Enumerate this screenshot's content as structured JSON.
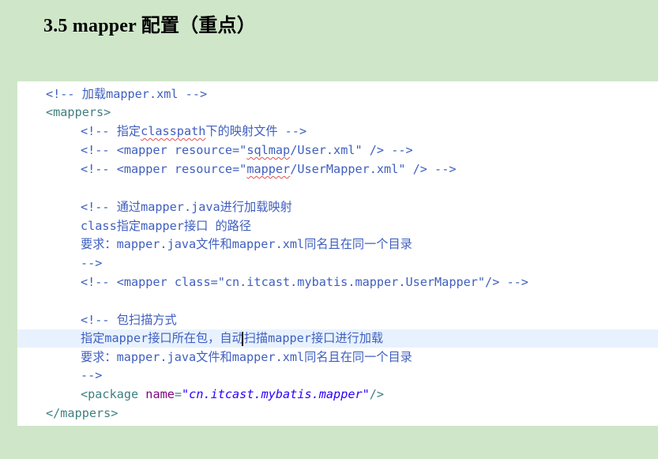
{
  "heading": "3.5 mapper 配置（重点）",
  "code": {
    "l1": "<!-- 加载mapper.xml -->",
    "l2": "<mappers>",
    "l3a": "<!-- 指定",
    "l3b": "classpath",
    "l3c": "下的映射文件 -->",
    "l4a": "<!-- <mapper resource=\"",
    "l4b": "sqlmap",
    "l4c": "/User.xml\" /> -->",
    "l5a": "<!-- <mapper resource=\"",
    "l5b": "mapper",
    "l5c": "/UserMapper.xml\" /> -->",
    "l6": "<!-- 通过mapper.java进行加载映射",
    "l7": "class指定mapper接口 的路径",
    "l8": "要求：mapper.java文件和mapper.xml同名且在同一个目录",
    "l9": "-->",
    "l10": "<!-- <mapper class=\"cn.itcast.mybatis.mapper.UserMapper\"/> -->",
    "l11": "<!-- 包扫描方式",
    "l12": "指定mapper接口所在包，自动扫描mapper接口进行加载",
    "l13": "要求：mapper.java文件和mapper.xml同名且在同一个目录",
    "l14": "-->",
    "l15_open": "<package ",
    "l15_attr": "name",
    "l15_eq": "=",
    "l15_val": "\"cn.itcast.mybatis.mapper\"",
    "l15_close": "/>",
    "l16": "</mappers>"
  },
  "colors": {
    "page_background": "#cfe6c9",
    "comment": "#3f5fbf",
    "tag": "#3f7f7f",
    "attribute": "#7f007f",
    "value": "#2a00ff",
    "current_line": "#e8f2fe"
  }
}
